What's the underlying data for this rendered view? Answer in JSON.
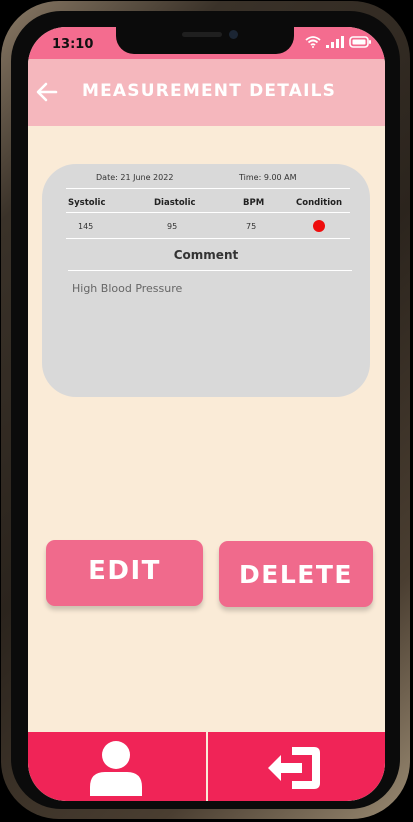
{
  "status": {
    "time": "13:10"
  },
  "header": {
    "title": "MEASUREMENT DETAILS"
  },
  "measurement": {
    "date": "Date: 21 June 2022",
    "time": "Time: 9.00 AM",
    "columns": [
      "Systolic",
      "Diastolic",
      "BPM",
      "Condition"
    ],
    "values": {
      "systolic": "145",
      "diastolic": "95",
      "bpm": "75"
    },
    "condition_color": "#ee0d0d",
    "comment_label": "Comment",
    "comment": "High Blood Pressure"
  },
  "actions": {
    "edit_label": "EDIT",
    "delete_label": "DELETE"
  },
  "bottom_nav": {
    "left_icon": "profile-icon",
    "right_icon": "logout-icon"
  },
  "colors": {
    "accent": "#f06a8c",
    "header": "#f5b7bd",
    "background": "#faebd7",
    "nav": "#f02457"
  }
}
